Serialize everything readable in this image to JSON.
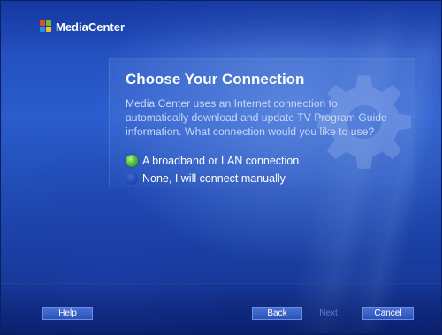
{
  "app": {
    "logo_text": "MediaCenter"
  },
  "dialog": {
    "title": "Choose Your Connection",
    "description": "Media Center uses an Internet connection to automatically download and update TV Program Guide information. What connection would you like to use?",
    "options": [
      {
        "label": "A broadband or LAN connection",
        "selected": true
      },
      {
        "label": "None, I will connect manually",
        "selected": false
      }
    ]
  },
  "buttons": {
    "help": "Help",
    "back": "Back",
    "next": "Next",
    "cancel": "Cancel"
  },
  "colors": {
    "background": "#1f47b5",
    "selected_radio": "#4cc23b",
    "unselected_radio": "#2249b2",
    "disabled_text": "#5b7fd0"
  },
  "icons": [
    "media-center-logo-icon",
    "gear-watermark-icon",
    "radio-selected-icon",
    "radio-unselected-icon"
  ]
}
